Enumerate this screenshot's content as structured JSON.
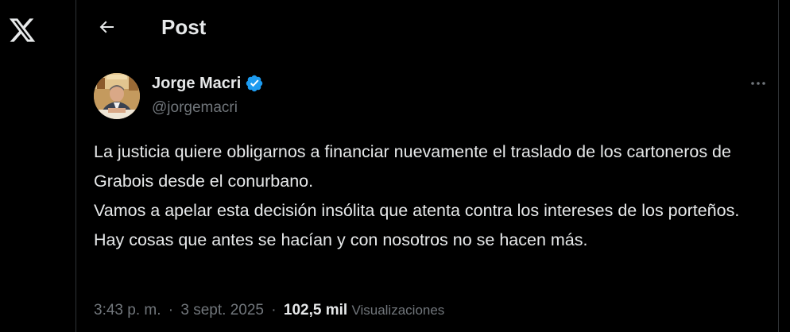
{
  "app": {
    "logo_icon": "x-logo-icon"
  },
  "header": {
    "back_icon": "arrow-left-icon",
    "title": "Post"
  },
  "author": {
    "name": "Jorge Macri",
    "handle": "@jorgemacri",
    "verified": true,
    "verified_color": "#1d9bf0"
  },
  "post": {
    "lines": [
      "La justicia quiere obligarnos a financiar nuevamente el traslado de los cartoneros de Grabois desde el conurbano.",
      "Vamos a apelar esta decisión insólita que atenta contra los intereses de los porteños.",
      "Hay cosas que antes se hacían y con nosotros no se hacen más."
    ],
    "time": "3:43 p. m.",
    "separator": "·",
    "date": "3 sept. 2025",
    "views_count": "102,5 mil",
    "views_label": "Visualizaciones"
  },
  "colors": {
    "background": "#000000",
    "text_primary": "#e7e9ea",
    "text_secondary": "#71767b",
    "border": "#2f3336"
  }
}
